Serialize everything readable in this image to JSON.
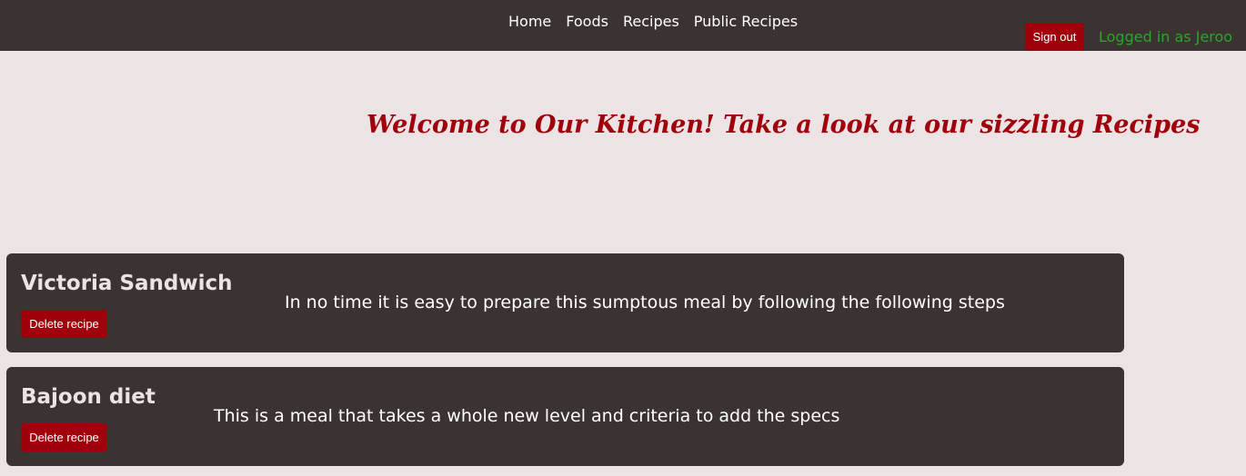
{
  "nav": {
    "links": [
      "Home",
      "Foods",
      "Recipes",
      "Public Recipes"
    ],
    "signout_label": "Sign out",
    "logged_in_text": "Logged in as Jeroo"
  },
  "hero": {
    "welcome": "Welcome to Our Kitchen! Take a look at our sizzling Recipes"
  },
  "recipes": [
    {
      "title": "Victoria Sandwich",
      "delete_label": "Delete recipe",
      "description": "In no time it is easy to prepare this sumptous meal by following the following steps"
    },
    {
      "title": "Bajoon diet",
      "delete_label": "Delete recipe",
      "description": "This is a meal that takes a whole new level and criteria to add the specs"
    }
  ],
  "colors": {
    "navbar_bg": "#3b3331",
    "page_bg": "#ece3e4",
    "accent_red": "#a0000c",
    "logged_in_green": "#2fa32a"
  }
}
